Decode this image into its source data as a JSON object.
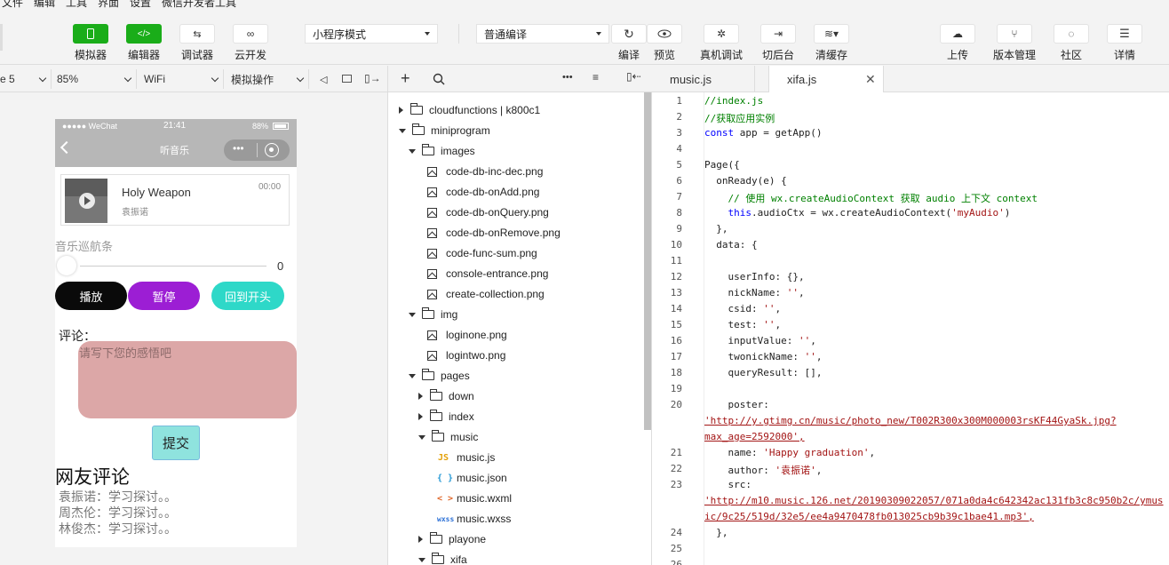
{
  "menu": [
    "文件",
    "编辑",
    "工具",
    "界面",
    "设置",
    "微信开发者工具"
  ],
  "toolbar": {
    "simulator": "模拟器",
    "editor": "编辑器",
    "debugger": "调试器",
    "cloud": "云开发",
    "mode": "小程序模式",
    "compile_mode": "普通编译",
    "compile": "编译",
    "preview": "预览",
    "remote_debug": "真机调试",
    "background": "切后台",
    "clear_cache": "清缓存",
    "upload": "上传",
    "version": "版本管理",
    "community": "社区",
    "details": "详情"
  },
  "subbar": {
    "device": "e 5",
    "zoom": "85%",
    "network": "WiFi",
    "sim_ops": "模拟操作"
  },
  "phone": {
    "carrier": "●●●●● WeChat",
    "time": "21:41",
    "battery": "88%",
    "title": "听音乐",
    "song_title": "Holy Weapon",
    "artist": "袁振诺",
    "song_time": "00:00",
    "slider_label": "音乐巡航条",
    "slider_value": "0",
    "slider_fraction": 0,
    "play": "播放",
    "pause": "暂停",
    "restart": "回到开头",
    "comment_label": "评论：",
    "comment_placeholder": "请写下您的感悟吧",
    "submit": "提交",
    "comments_title": "网友评论",
    "comments": [
      "袁振诺：学习探讨。。",
      "周杰伦：学习探讨。。",
      "林俊杰：学习探讨。。"
    ]
  },
  "tree": [
    {
      "label": "cloudfunctions | k800c1",
      "type": "folder",
      "expanded": false,
      "indent": 0
    },
    {
      "label": "miniprogram",
      "type": "folder",
      "expanded": true,
      "indent": 0
    },
    {
      "label": "images",
      "type": "folder",
      "expanded": true,
      "indent": 1
    },
    {
      "label": "code-db-inc-dec.png",
      "type": "img",
      "indent": 2
    },
    {
      "label": "code-db-onAdd.png",
      "type": "img",
      "indent": 2
    },
    {
      "label": "code-db-onQuery.png",
      "type": "img",
      "indent": 2
    },
    {
      "label": "code-db-onRemove.png",
      "type": "img",
      "indent": 2
    },
    {
      "label": "code-func-sum.png",
      "type": "img",
      "indent": 2
    },
    {
      "label": "console-entrance.png",
      "type": "img",
      "indent": 2
    },
    {
      "label": "create-collection.png",
      "type": "img",
      "indent": 2
    },
    {
      "label": "img",
      "type": "folder",
      "expanded": true,
      "indent": 1
    },
    {
      "label": "loginone.png",
      "type": "img",
      "indent": 2
    },
    {
      "label": "logintwo.png",
      "type": "img",
      "indent": 2
    },
    {
      "label": "pages",
      "type": "folder",
      "expanded": true,
      "indent": 1
    },
    {
      "label": "down",
      "type": "folder",
      "expanded": false,
      "indent": 2
    },
    {
      "label": "index",
      "type": "folder",
      "expanded": false,
      "indent": 2
    },
    {
      "label": "music",
      "type": "folder",
      "expanded": true,
      "indent": 2
    },
    {
      "label": "music.js",
      "type": "js",
      "indent": 3
    },
    {
      "label": "music.json",
      "type": "json",
      "indent": 3
    },
    {
      "label": "music.wxml",
      "type": "wxml",
      "indent": 3
    },
    {
      "label": "music.wxss",
      "type": "wxss",
      "indent": 3
    },
    {
      "label": "playone",
      "type": "folder",
      "expanded": false,
      "indent": 2
    },
    {
      "label": "xifa",
      "type": "folder",
      "expanded": true,
      "indent": 2
    }
  ],
  "file_icons": {
    "js": "JS",
    "json": "{ }",
    "wxml": "< >",
    "wxss": "wxss"
  },
  "tabs": [
    "music.js",
    "xifa.js"
  ],
  "code": [
    {
      "n": "1",
      "t": "//index.js",
      "c": "cm"
    },
    {
      "n": "2",
      "t": "//获取应用实例",
      "c": "cm"
    },
    {
      "n": "3",
      "t": "const app = getApp()",
      "c": ""
    },
    {
      "n": "4",
      "t": "",
      "c": ""
    },
    {
      "n": "5",
      "t": "Page({",
      "c": ""
    },
    {
      "n": "6",
      "t": "  onReady(e) {",
      "c": ""
    },
    {
      "n": "7",
      "t": "    // 使用 wx.createAudioContext 获取 audio 上下文 context",
      "c": "cm"
    },
    {
      "n": "8",
      "t": "    this.audioCtx = wx.createAudioContext('myAudio')",
      "c": ""
    },
    {
      "n": "9",
      "t": "  },",
      "c": ""
    },
    {
      "n": "10",
      "t": "  data: {",
      "c": ""
    },
    {
      "n": "11",
      "t": "",
      "c": ""
    },
    {
      "n": "12",
      "t": "    userInfo: {},",
      "c": ""
    },
    {
      "n": "13",
      "t": "    nickName: '',",
      "c": ""
    },
    {
      "n": "14",
      "t": "    csid: '',",
      "c": ""
    },
    {
      "n": "15",
      "t": "    test: '',",
      "c": ""
    },
    {
      "n": "16",
      "t": "    inputValue: '',",
      "c": ""
    },
    {
      "n": "17",
      "t": "    twonickName: '',",
      "c": ""
    },
    {
      "n": "18",
      "t": "    queryResult: [],",
      "c": ""
    },
    {
      "n": "19",
      "t": "",
      "c": ""
    },
    {
      "n": "20",
      "t": "    poster:",
      "c": ""
    },
    {
      "n": "",
      "t": "'http://y.gtimg.cn/music/photo_new/T002R300x300M000003rsKF44GyaSk.jpg?",
      "c": "wr"
    },
    {
      "n": "",
      "t": "max_age=2592000',",
      "c": "wr"
    },
    {
      "n": "21",
      "t": "    name: 'Happy graduation',",
      "c": ""
    },
    {
      "n": "22",
      "t": "    author: '袁振诺',",
      "c": ""
    },
    {
      "n": "23",
      "t": "    src:",
      "c": ""
    },
    {
      "n": "",
      "t": "'http://m10.music.126.net/20190309022057/071a0da4c642342ac131fb3c8c950b2c/ymus",
      "c": "wr"
    },
    {
      "n": "",
      "t": "ic/9c25/519d/32e5/ee4a9470478fb013025cb9b39c1bae41.mp3',",
      "c": "wr"
    },
    {
      "n": "24",
      "t": "  },",
      "c": ""
    },
    {
      "n": "25",
      "t": "",
      "c": ""
    },
    {
      "n": "26",
      "t": "",
      "c": ""
    }
  ]
}
